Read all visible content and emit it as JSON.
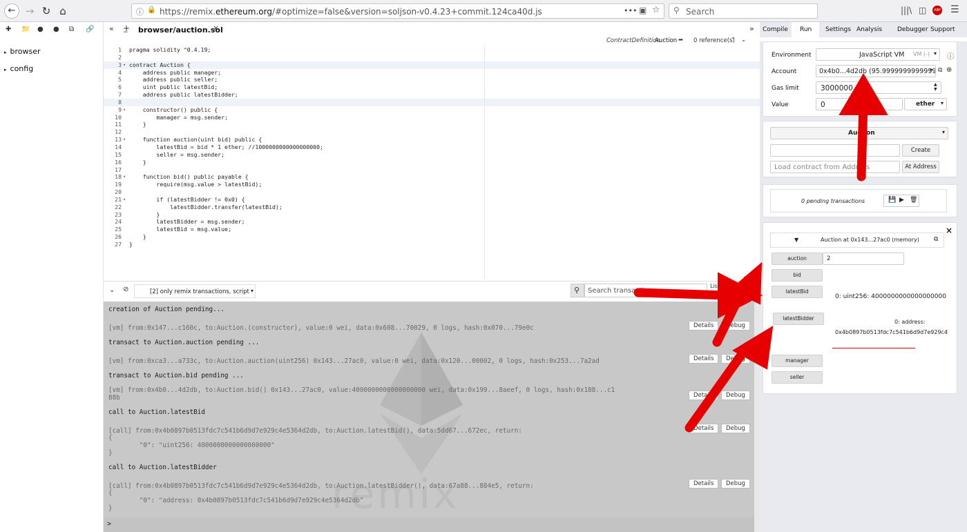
{
  "browser": {
    "url_prefix": "https://remix.",
    "url_domain": "ethereum.org",
    "url_rest": "/#optimize=false&version=soljson-v0.4.23+commit.124ca40d.js",
    "search_placeholder": "Search",
    "menu_dots": "•••",
    "addon_badge": "ABP"
  },
  "file_panel": {
    "items": [
      {
        "label": "browser"
      },
      {
        "label": "config"
      }
    ]
  },
  "editor": {
    "tab_title": "browser/auction.sol",
    "tab_close": "×",
    "contract_definition_label": "ContractDefinition",
    "contract_name": "Auction",
    "references": "0 reference(s)",
    "lines": [
      "pragma solidity ^0.4.19;",
      "",
      "contract Auction {",
      "    address public manager;",
      "    address public seller;",
      "    uint public latestBid;",
      "    address public latestBidder;",
      "    ",
      "    constructor() public {",
      "        manager = msg.sender;",
      "    }",
      "",
      "    function auction(uint bid) public {",
      "        latestBid = bid * 1 ether; //1000000000000000000;",
      "        seller = msg.sender;",
      "    }",
      "",
      "    function bid() public payable {",
      "        require(msg.value > latestBid);",
      "",
      "        if (latestBidder != 0x0) {",
      "            latestBidder.transfer(latestBid);",
      "        }",
      "        latestBidder = msg.sender;",
      "        latestBid = msg.value;",
      "    }",
      "}"
    ]
  },
  "terminal": {
    "filter_label": "[2] only remix transactions, script",
    "search_placeholder": "Search transactions",
    "listen_label": "Listen",
    "details_label": "Details",
    "debug_label": "Debug",
    "prompt": ">",
    "watermark": "remix",
    "entries": [
      {
        "title": "creation of Auction pending...",
        "detail": "[vm] from:0x147...c160c, to:Auction.(constructor), value:0 wei, data:0x608...70029, 0 logs, hash:0x070...79e0c"
      },
      {
        "title": "transact to Auction.auction pending ...",
        "detail": "[vm] from:0xca3...a733c, to:Auction.auction(uint256) 0x143...27ac0, value:0 wei, data:0x120...00002, 0 logs, hash:0x253...7a2ad"
      },
      {
        "title": "transact to Auction.bid pending ...",
        "detail": "[vm] from:0x4b0...4d2db, to:Auction.bid() 0x143...27ac0, value:4000000000000000000 wei, data:0x199...8aeef, 0 logs, hash:0x188...c1",
        "detail2": "88b"
      },
      {
        "title": "call to Auction.latestBid",
        "detail": "[call] from:0x4b0897b0513fdc7c541b6d9d7e929c4e5364d2db, to:Auction.latestBid(), data:5dd67...672ec, return:",
        "json_open": "{",
        "json_body": "        \"0\": \"uint256: 4000000000000000000\"",
        "json_close": "}"
      },
      {
        "title": "call to Auction.latestBidder",
        "detail": "[call] from:0x4b0897b0513fdc7c541b6d9d7e929c4e5364d2db, to:Auction.latestBidder(), data:67a88...884e5, return:",
        "json_open": "{",
        "json_body": "        \"0\": \"address: 0x4b0897b0513fdc7c541b6d9d7e929c4e5364d2db\"",
        "json_close": "}"
      }
    ]
  },
  "right_panel": {
    "tabs": [
      "Compile",
      "Run",
      "Settings",
      "Analysis",
      "Debugger",
      "Support"
    ],
    "active_tab": "Run",
    "environment_label": "Environment",
    "environment_value": "JavaScript VM",
    "vm_badge": "VM (-)",
    "account_label": "Account",
    "account_value": "0x4b0...4d2db (95.99999999999995",
    "gas_limit_label": "Gas limit",
    "gas_limit_value": "3000000",
    "value_label": "Value",
    "value_value": "0",
    "value_unit": "ether",
    "contract_select": "Auction",
    "create_label": "Create",
    "load_placeholder": "Load contract from Address",
    "at_address_label": "At Address",
    "pending_label": "0 pending transactions",
    "instance_title": "Auction at 0x143...27ac0 (memory)",
    "auction_label": "auction",
    "auction_arg": "2",
    "bid_label": "bid",
    "latest_bid_label": "latestBid",
    "latest_bid_result": "0: uint256: 4000000000000000000",
    "latest_bidder_label": "latestBidder",
    "latest_bidder_result_key": "0: address:",
    "latest_bidder_result_val": "0x4b0897b0513fdc7c541b6d9d7e929c4",
    "manager_label": "manager",
    "seller_label": "seller",
    "close_symbol": "×"
  },
  "colors": {
    "annotation_arrow": "#e60000",
    "terminal_bg": "#c8c8c8",
    "panel_bg": "#e9eaef"
  }
}
